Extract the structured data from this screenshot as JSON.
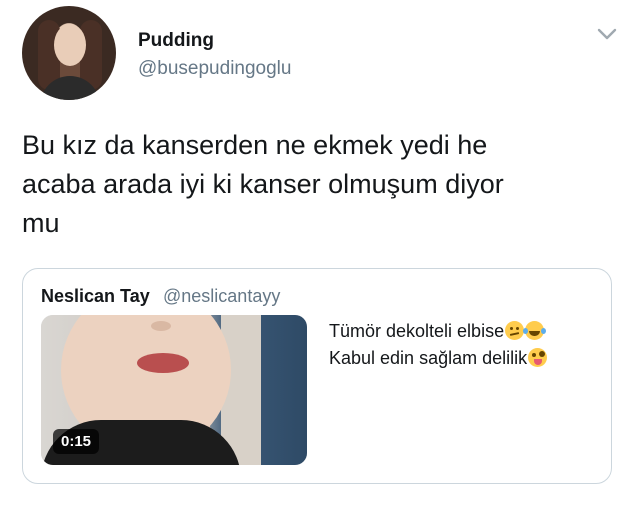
{
  "author": {
    "display_name": "Pudding",
    "handle": "@busepudingoglu"
  },
  "tweet": {
    "text": "Bu kız da kanserden ne ekmek yedi he\nacaba arada iyi ki kanser olmuşum diyor\nmu"
  },
  "quoted_tweet": {
    "display_name": "Neslican Tay",
    "handle": "@neslicantayy",
    "line1": "Tümör dekolteli elbise",
    "line2": "Kabul edin sağlam delilik",
    "line1_emojis": [
      "confused-face-emoji",
      "tears-of-joy-emoji"
    ],
    "line2_emojis": [
      "zany-face-emoji"
    ],
    "video_duration": "0:15"
  },
  "icons": {
    "menu": "chevron-down-icon"
  },
  "colors": {
    "primary_text": "#14171a",
    "secondary_text": "#657786",
    "border": "#ccd6dd"
  }
}
